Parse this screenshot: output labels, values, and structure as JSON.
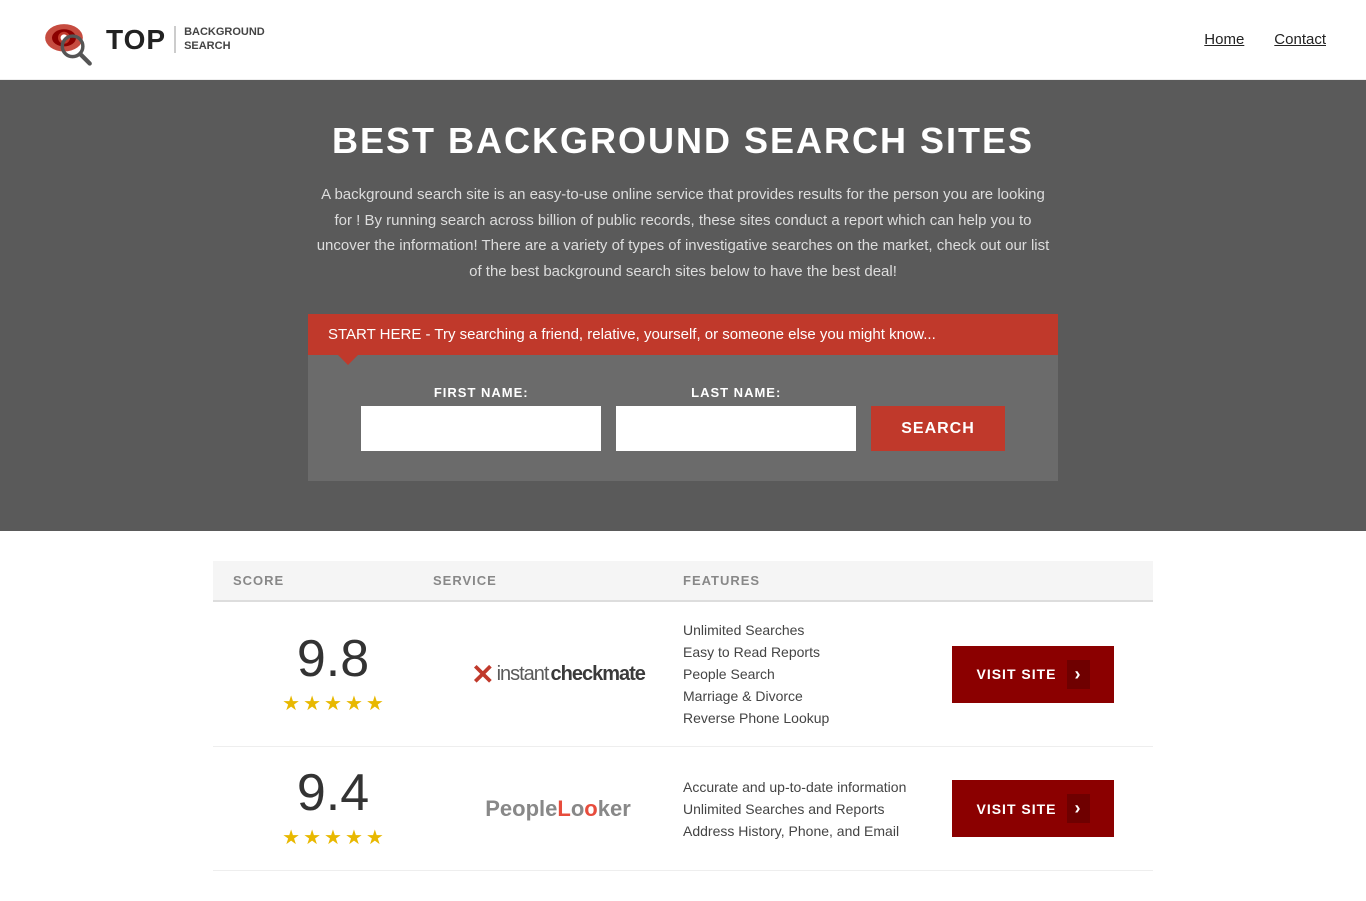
{
  "header": {
    "logo_top": "TOP",
    "logo_sub_line1": "BACKGROUND",
    "logo_sub_line2": "SEARCH",
    "nav": {
      "home": "Home",
      "contact": "Contact"
    }
  },
  "hero": {
    "title": "BEST BACKGROUND SEARCH SITES",
    "description": "A background search site is an easy-to-use online service that provides results  for the person you are looking for ! By  running  search across billion of public records, these sites conduct  a report which can help you to uncover the information! There are a variety of types of investigative searches on the market, check out our  list of the best background search sites below to have the best deal!",
    "banner_text": "START HERE - Try searching a friend, relative, yourself, or someone else you might know...",
    "first_name_label": "FIRST NAME:",
    "last_name_label": "LAST NAME:",
    "search_button": "SEARCH"
  },
  "table": {
    "headers": {
      "score": "SCORE",
      "service": "SERVICE",
      "features": "FEATURES",
      "action": ""
    },
    "rows": [
      {
        "score": "9.8",
        "stars": 4.5,
        "service_name": "Instant Checkmate",
        "service_logo_type": "checkmate",
        "features": [
          "Unlimited Searches",
          "Easy to Read Reports",
          "People Search",
          "Marriage & Divorce",
          "Reverse Phone Lookup"
        ],
        "visit_label": "VISIT SITE"
      },
      {
        "score": "9.4",
        "stars": 4.5,
        "service_name": "PeopleLooker",
        "service_logo_type": "peoplelooker",
        "features": [
          "Accurate and up-to-date information",
          "Unlimited Searches and Reports",
          "Address History, Phone, and Email"
        ],
        "visit_label": "VISIT SITE"
      }
    ]
  }
}
